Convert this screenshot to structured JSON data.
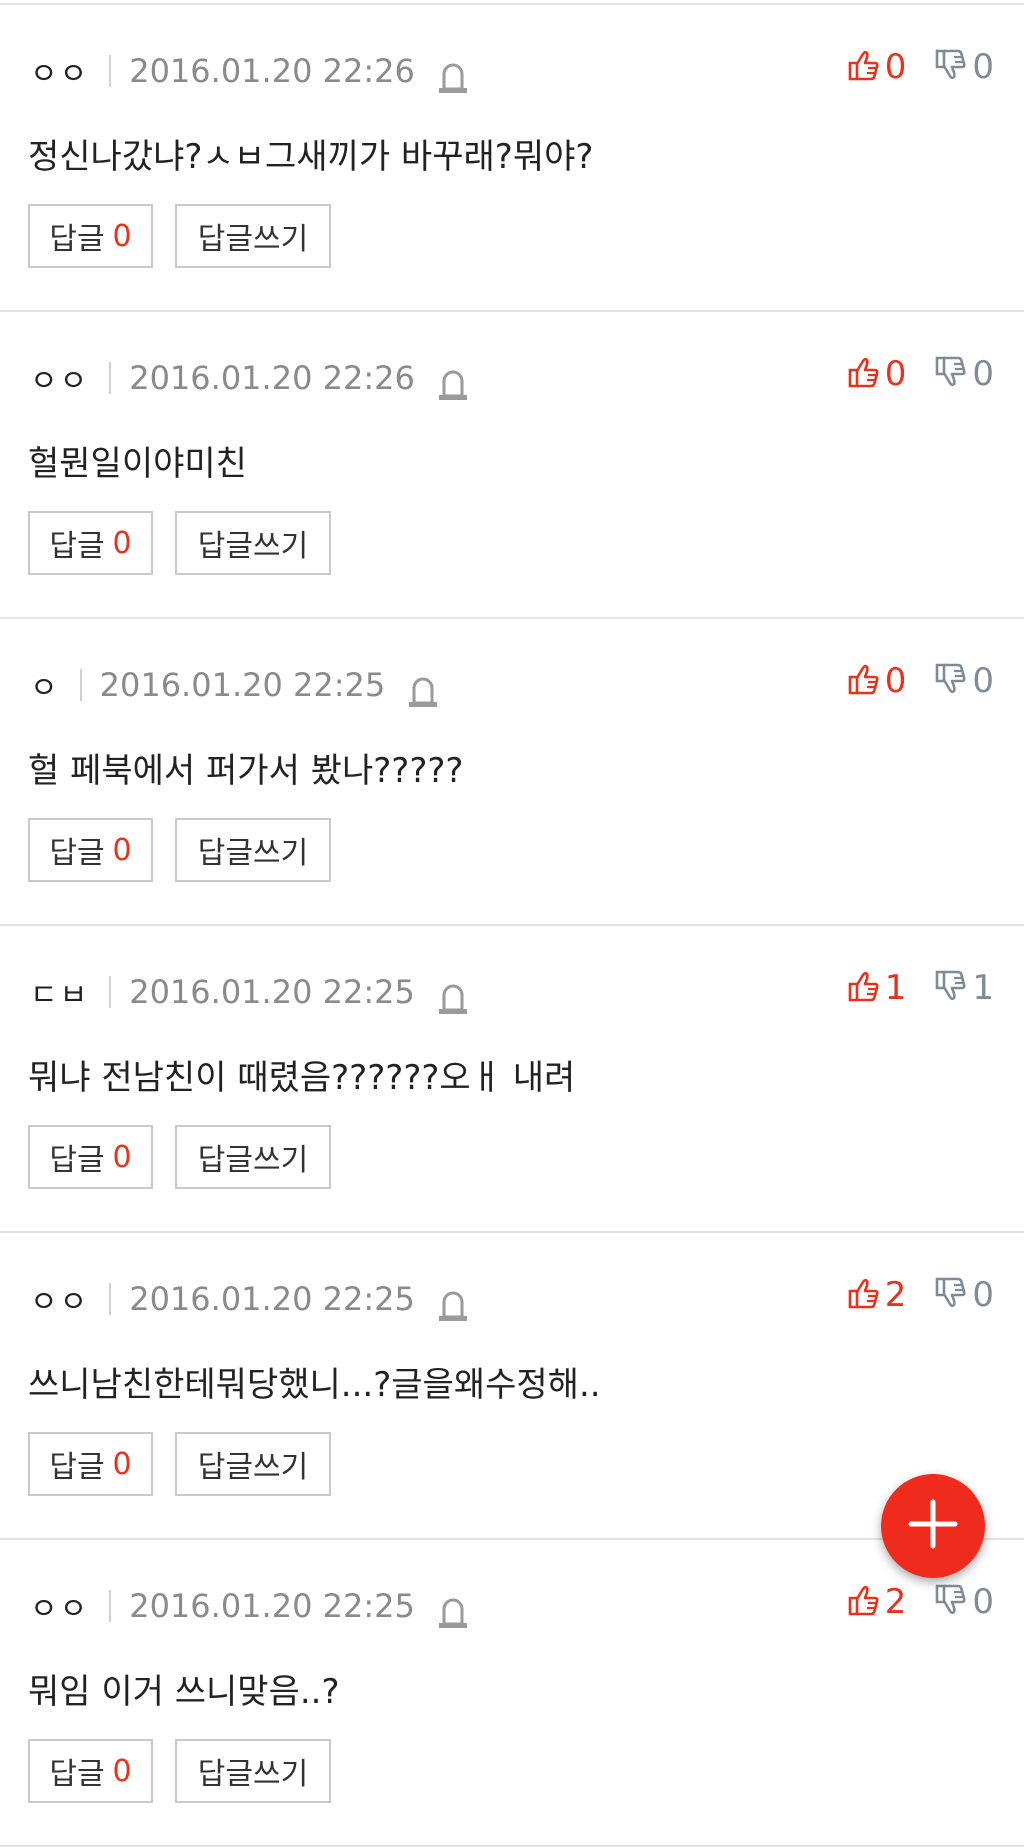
{
  "comments": [
    {
      "nickname": "ㅇㅇ",
      "date": "2016.01.20 22:26",
      "text": "정신나갔냐?ㅅㅂ그새끼가 바꾸래?뭐야?",
      "likes": "0",
      "dislikes": "0",
      "reply_label": "답글",
      "reply_count": "0",
      "write_label": "답글쓰기"
    },
    {
      "nickname": "ㅇㅇ",
      "date": "2016.01.20 22:26",
      "text": "헐뭔일이야미친",
      "likes": "0",
      "dislikes": "0",
      "reply_label": "답글",
      "reply_count": "0",
      "write_label": "답글쓰기"
    },
    {
      "nickname": "ㅇ",
      "date": "2016.01.20 22:25",
      "text": "헐 페북에서 퍼가서 봤나?????",
      "likes": "0",
      "dislikes": "0",
      "reply_label": "답글",
      "reply_count": "0",
      "write_label": "답글쓰기"
    },
    {
      "nickname": "ㄷㅂ",
      "date": "2016.01.20 22:25",
      "text": "뭐냐 전남친이 때렸음??????오ㅐ 내려",
      "likes": "1",
      "dislikes": "1",
      "reply_label": "답글",
      "reply_count": "0",
      "write_label": "답글쓰기"
    },
    {
      "nickname": "ㅇㅇ",
      "date": "2016.01.20 22:25",
      "text": "쓰니남친한테뭐당했니...?글을왜수정해..",
      "likes": "2",
      "dislikes": "0",
      "reply_label": "답글",
      "reply_count": "0",
      "write_label": "답글쓰기"
    },
    {
      "nickname": "ㅇㅇ",
      "date": "2016.01.20 22:25",
      "text": "뭐임 이거 쓰니맞음..?",
      "likes": "2",
      "dislikes": "0",
      "reply_label": "답글",
      "reply_count": "0",
      "write_label": "답글쓰기"
    }
  ],
  "colors": {
    "accent_red": "#e8321d",
    "dislike_gray": "#7f8c97",
    "date_gray": "#8a8a8a",
    "fab_red": "#ef2b1e"
  },
  "icons": {
    "report": "siren-icon",
    "like": "thumbs-up-icon",
    "dislike": "thumbs-down-icon",
    "fab": "plus-icon"
  }
}
